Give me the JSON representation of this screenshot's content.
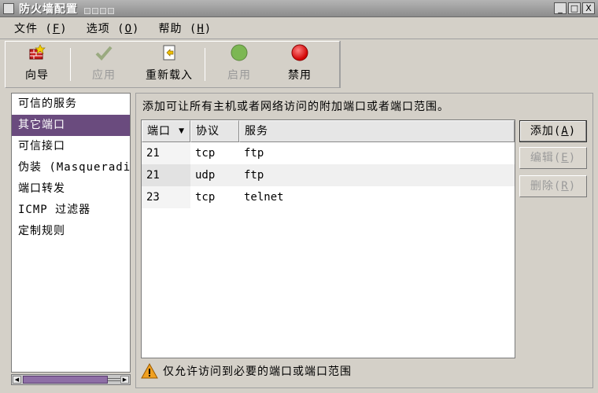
{
  "window": {
    "title": "防火墙配置",
    "controls": [
      "_",
      "□",
      "X"
    ]
  },
  "menu": [
    {
      "label": "文件",
      "key": "F"
    },
    {
      "label": "选项",
      "key": "O"
    },
    {
      "label": "帮助",
      "key": "H"
    }
  ],
  "toolbar": {
    "wizard": "向导",
    "apply": "应用",
    "reload": "重新载入",
    "enable": "启用",
    "disable": "禁用"
  },
  "sidebar": {
    "items": [
      {
        "label": "可信的服务"
      },
      {
        "label": "其它端口"
      },
      {
        "label": "可信接口"
      },
      {
        "label": "伪装 (Masquerading)"
      },
      {
        "label": "端口转发"
      },
      {
        "label": "ICMP 过滤器"
      },
      {
        "label": "定制规则"
      }
    ],
    "selected_index": 1
  },
  "main": {
    "description": "添加可让所有主机或者网络访问的附加端口或者端口范围。",
    "table": {
      "columns": [
        "端口",
        "协议",
        "服务"
      ],
      "rows": [
        {
          "port": "21",
          "protocol": "tcp",
          "service": "ftp"
        },
        {
          "port": "21",
          "protocol": "udp",
          "service": "ftp"
        },
        {
          "port": "23",
          "protocol": "tcp",
          "service": "telnet"
        }
      ]
    },
    "buttons": {
      "add": {
        "label": "添加",
        "key": "A"
      },
      "edit": {
        "label": "编辑",
        "key": "E"
      },
      "delete": {
        "label": "删除",
        "key": "R"
      }
    },
    "note": "仅允许访问到必要的端口或端口范围"
  },
  "colors": {
    "selection": "#6a4b7e",
    "enable_icon": "#6db33f",
    "disable_icon": "#e01010",
    "warning": "#f0a020"
  }
}
